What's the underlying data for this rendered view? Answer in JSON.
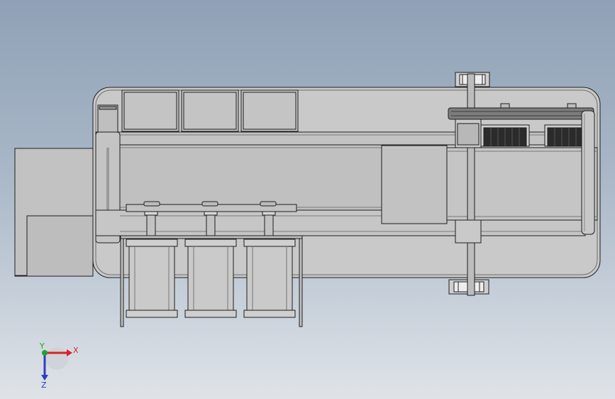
{
  "view": {
    "title": "",
    "background_top": "#8fa1b6",
    "background_bottom": "#dfe3e8"
  },
  "model": {
    "part_fill": "#c6c6c6",
    "part_fill_dark": "#a9a9a9",
    "edge_color": "#1e1e1e",
    "motor_dark": "#2b2b2b",
    "cylinder_count": 3,
    "pulley_count": 3,
    "stepper_motor_count": 2
  },
  "triad": {
    "x_label": "X",
    "y_label": "Y",
    "z_label": "Z",
    "x_color": "#d9202a",
    "y_color": "#22a235",
    "z_color": "#2b3fbf"
  }
}
